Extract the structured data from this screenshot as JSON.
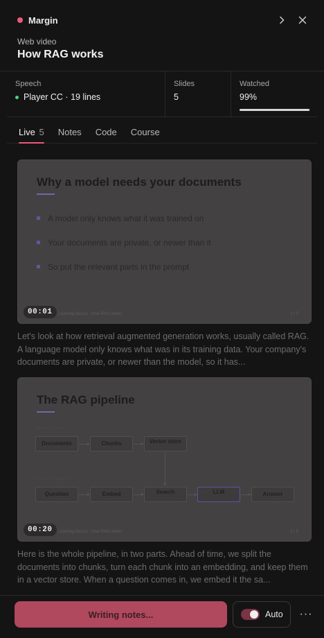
{
  "header": {
    "app_name": "Margin",
    "source_type": "Web video",
    "title": "How RAG works",
    "icons": [
      "chevron-right-icon",
      "close-icon"
    ]
  },
  "stats": {
    "speech": {
      "label": "Speech",
      "value": "Player CC · 19 lines",
      "status_color": "#4fd184"
    },
    "slides": {
      "label": "Slides",
      "value": "5"
    },
    "watched": {
      "label": "Watched",
      "value": "99%",
      "progress": 0.99
    }
  },
  "tabs": [
    {
      "label": "Live",
      "count": "5",
      "active": true
    },
    {
      "label": "Notes"
    },
    {
      "label": "Code"
    },
    {
      "label": "Course"
    }
  ],
  "slides": [
    {
      "title": "Why a model needs your documents",
      "bullets": [
        "A model only knows what it was trained on",
        "Your documents are private, or newer than it",
        "So put the relevant parts in the prompt"
      ],
      "footer_left": "Learning Basics · How RAG works",
      "footer_right": "1 / 5",
      "timecode": "00:01",
      "transcript": "Let's look at how retrieval augmented generation works, usually called RAG. A language model only knows what was in its training data. Your company's documents are private, or newer than the model, so it has..."
    },
    {
      "title": "The RAG pipeline",
      "pipeline": {
        "ahead_label": "Ahead of time",
        "question_label": "For each question",
        "documents": "Documents",
        "chunks": "Chunks",
        "vector_store": "Vector store",
        "vector_store_sub": "embeddings",
        "question": "Question",
        "embed": "Embed",
        "search": "Search",
        "search_sub": "top chunks",
        "llm": "LLM",
        "llm_sub": "chunks + question",
        "answer": "Answer"
      },
      "footer_left": "Learning Basics · How RAG works",
      "footer_right": "2 / 5",
      "timecode": "00:20",
      "transcript": "Here is the whole pipeline, in two parts. Ahead of time, we split the documents into chunks, turn each chunk into an embedding, and keep them in a vector store. When a question comes in, we embed it the sa..."
    }
  ],
  "footer": {
    "primary_button": "Writing notes...",
    "auto_label": "Auto",
    "auto_on": true,
    "more_label": "···"
  },
  "colors": {
    "accent": "#e95a79",
    "background": "#151414",
    "primary_button": "#b0485e"
  }
}
